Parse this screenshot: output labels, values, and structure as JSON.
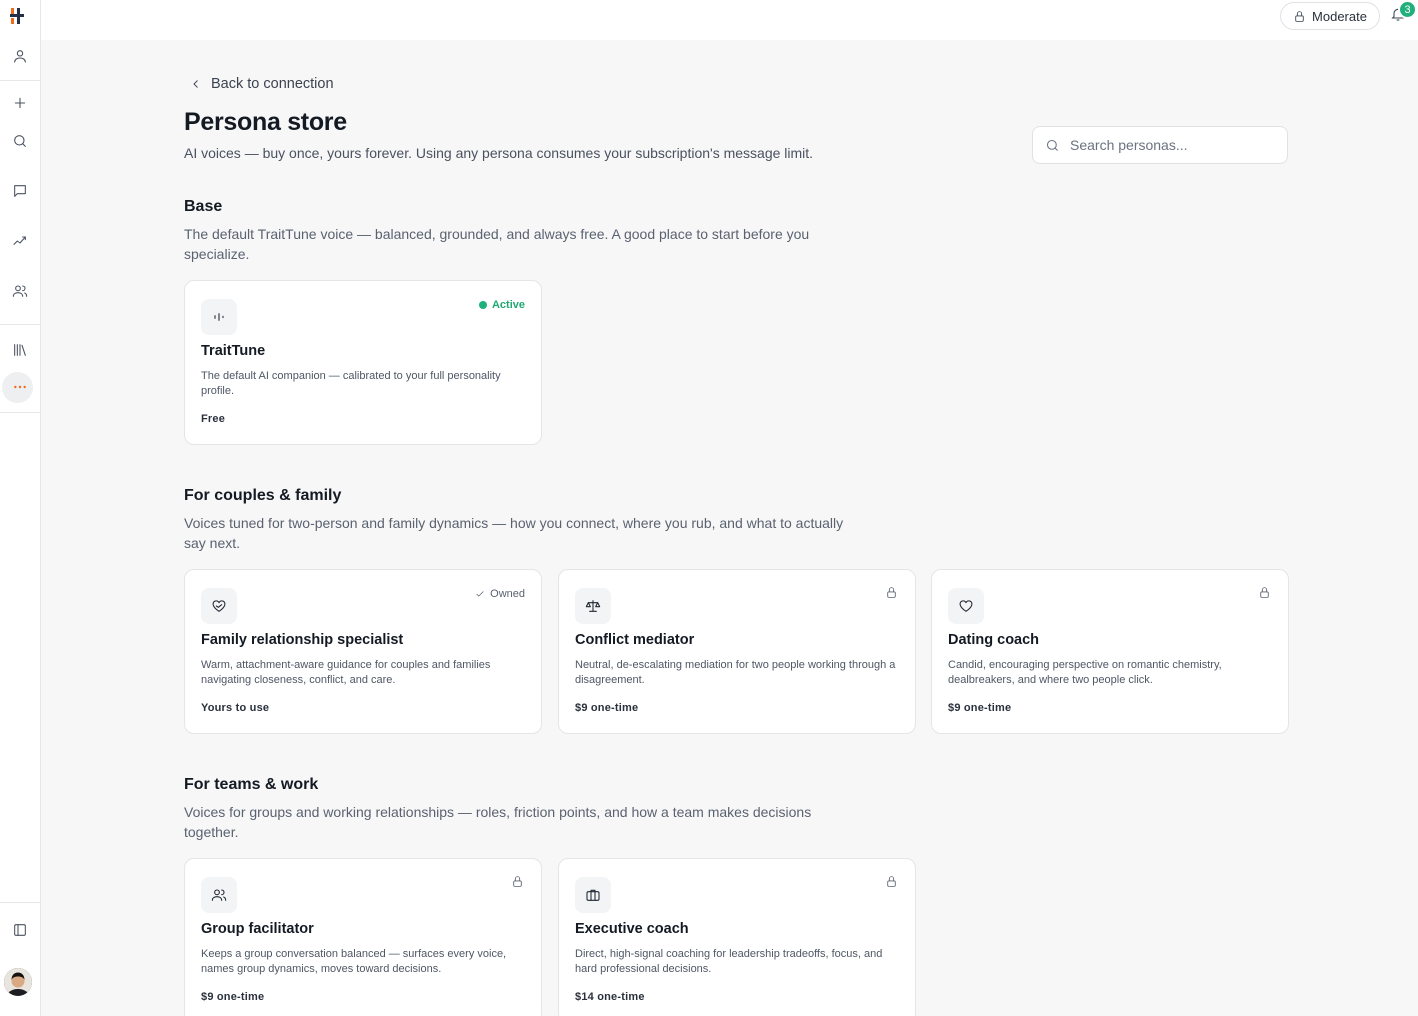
{
  "colors": {
    "accent": "#1fb07c",
    "logo_orange": "#f26a1b",
    "logo_dark": "#23304a"
  },
  "sidebar": {
    "items": [
      {
        "name": "profile",
        "icon": "user-icon"
      },
      {
        "name": "new",
        "icon": "plus-icon"
      },
      {
        "name": "search",
        "icon": "search-icon"
      },
      {
        "name": "chat",
        "icon": "message-icon"
      },
      {
        "name": "insights",
        "icon": "sparkle-icon"
      },
      {
        "name": "people",
        "icon": "users-icon"
      },
      {
        "name": "library",
        "icon": "library-icon"
      },
      {
        "name": "more",
        "icon": "more-icon"
      }
    ]
  },
  "topbar": {
    "mode_label": "Moderate",
    "notification_count": "3"
  },
  "header": {
    "back_label": "Back to connection",
    "title": "Persona store",
    "subtitle": "AI voices — buy once, yours forever. Using any persona consumes your subscription's message limit.",
    "search_placeholder": "Search personas..."
  },
  "sections": [
    {
      "title": "Base",
      "description": "The default TraitTune voice — balanced, grounded, and always free. A good place to start before you specialize.",
      "cards": [
        {
          "name": "TraitTune",
          "description": "The default AI companion — calibrated to your full personality profile.",
          "price": "Free",
          "status": "Active",
          "icon": "waveform-icon"
        }
      ]
    },
    {
      "title": "For couples & family",
      "description": "Voices tuned for two-person and family dynamics — how you connect, where you rub, and what to actually say next.",
      "cards": [
        {
          "name": "Family relationship specialist",
          "description": "Warm, attachment-aware guidance for couples and families navigating closeness, conflict, and care.",
          "price": "Yours to use",
          "status": "Owned",
          "icon": "heart-handshake-icon"
        },
        {
          "name": "Conflict mediator",
          "description": "Neutral, de-escalating mediation for two people working through a disagreement.",
          "price": "$9 one-time",
          "status": "locked",
          "icon": "scale-icon"
        },
        {
          "name": "Dating coach",
          "description": "Candid, encouraging perspective on romantic chemistry, dealbreakers, and where two people click.",
          "price": "$9 one-time",
          "status": "locked",
          "icon": "heart-icon"
        }
      ]
    },
    {
      "title": "For teams & work",
      "description": "Voices for groups and working relationships — roles, friction points, and how a team makes decisions together.",
      "cards": [
        {
          "name": "Group facilitator",
          "description": "Keeps a group conversation balanced — surfaces every voice, names group dynamics, moves toward decisions.",
          "price": "$9 one-time",
          "status": "locked",
          "icon": "users-icon"
        },
        {
          "name": "Executive coach",
          "description": "Direct, high-signal coaching for leadership tradeoffs, focus, and hard professional decisions.",
          "price": "$14 one-time",
          "status": "locked",
          "icon": "briefcase-icon"
        }
      ]
    }
  ]
}
